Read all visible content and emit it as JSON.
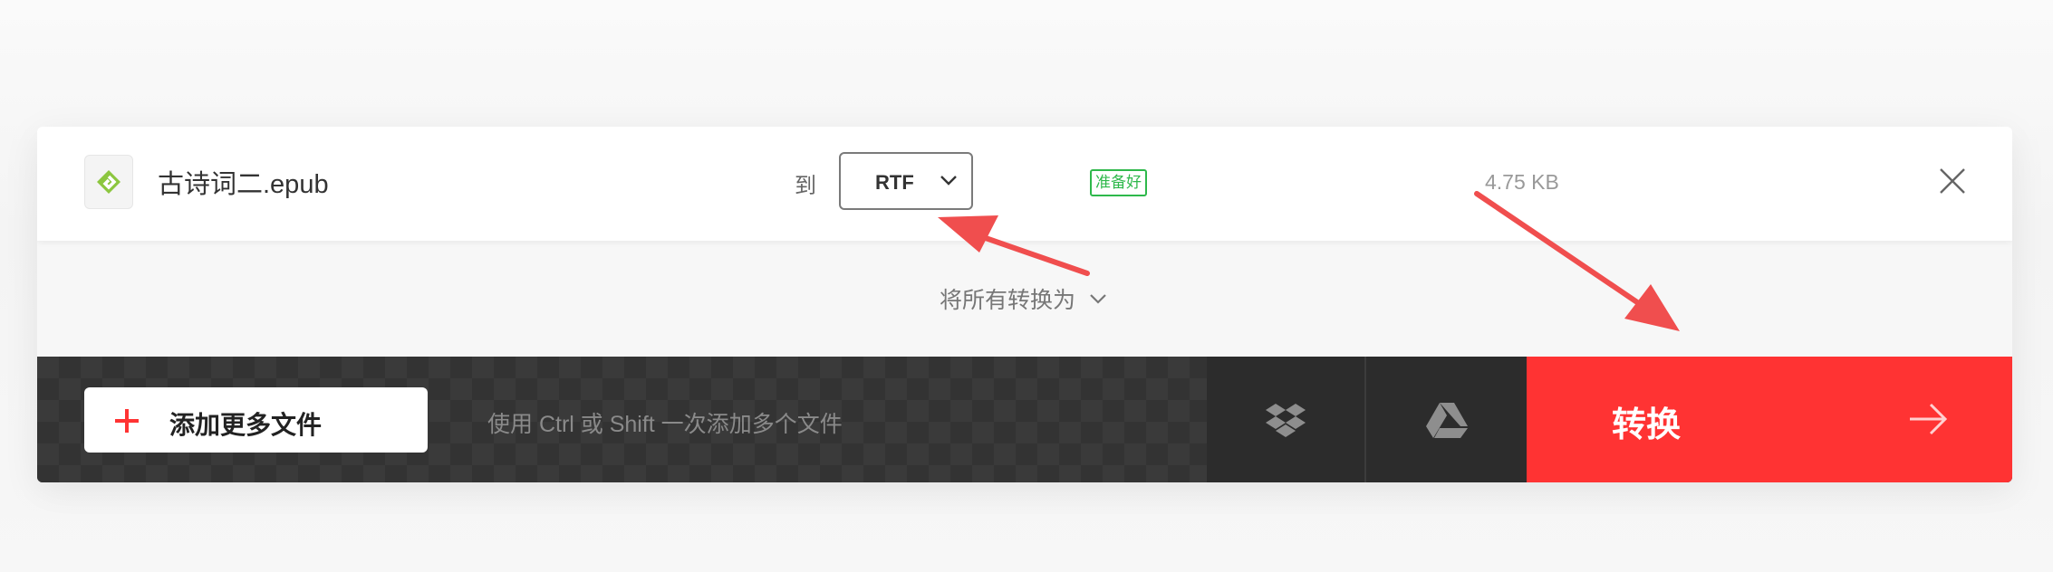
{
  "file": {
    "name": "古诗词二.epub",
    "to_label": "到",
    "format": "RTF",
    "status": "准备好",
    "size": "4.75 KB"
  },
  "convert_all": {
    "label": "将所有转换为"
  },
  "bottom_bar": {
    "add_files_label": "添加更多文件",
    "hint": "使用 Ctrl 或 Shift 一次添加多个文件",
    "convert_label": "转换"
  },
  "colors": {
    "accent": "#ff3333",
    "status_green": "#2eb84b",
    "epub_green": "#8cc63f",
    "annotation_arrow": "#f04e4e"
  },
  "icons": {
    "file_type": "epub-icon",
    "format_dropdown": "chevron-down-icon",
    "close": "close-icon",
    "add": "plus-icon",
    "dropbox": "dropbox-icon",
    "gdrive": "google-drive-icon",
    "convert": "arrow-right-icon"
  }
}
